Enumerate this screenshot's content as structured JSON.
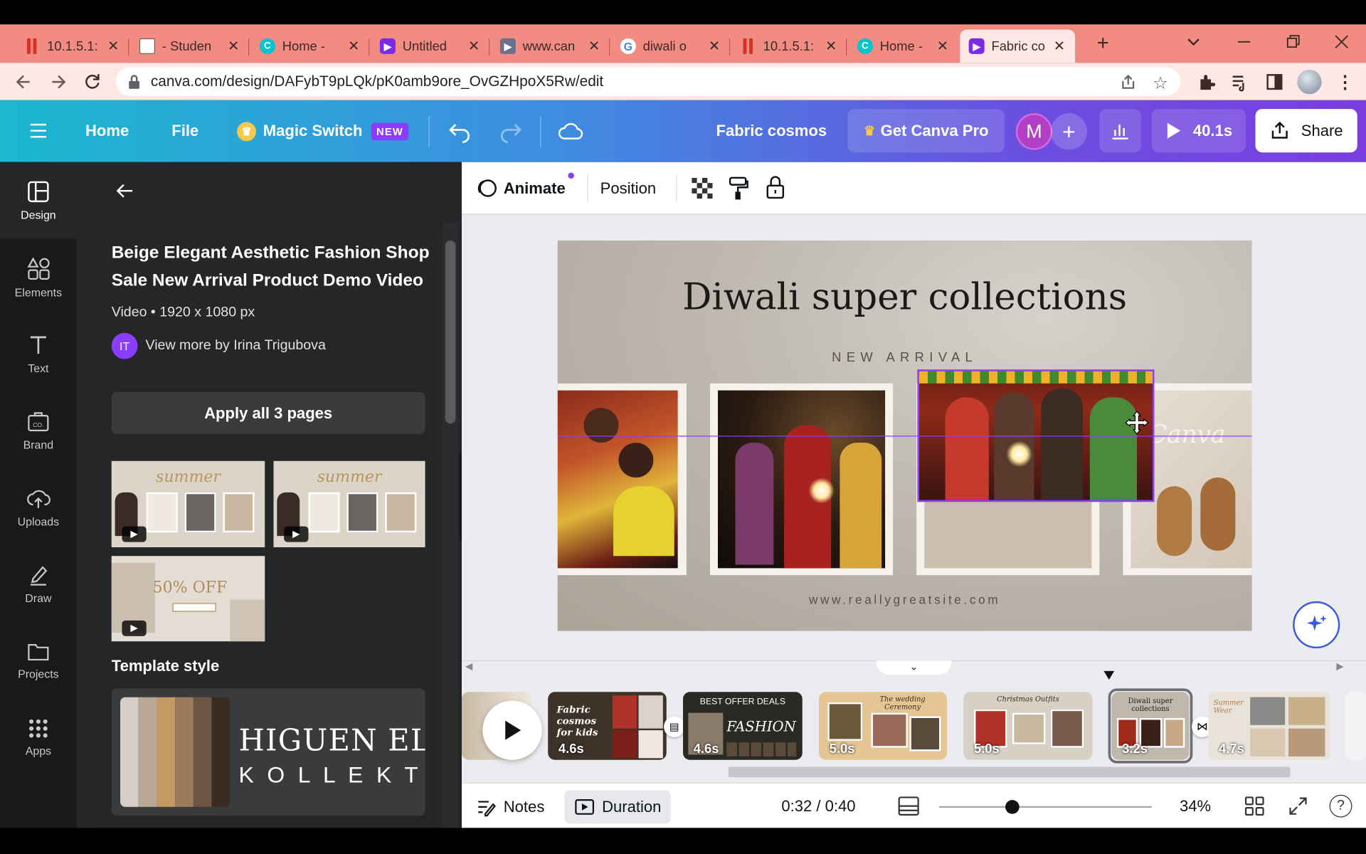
{
  "browser": {
    "tabs": [
      {
        "label": "10.1.5.1:",
        "favicon": "pause-bars"
      },
      {
        "label": "- Studen",
        "favicon": "student-portal"
      },
      {
        "label": "Home -",
        "favicon": "canva"
      },
      {
        "label": "Untitled",
        "favicon": "video"
      },
      {
        "label": "www.can",
        "favicon": "video-play"
      },
      {
        "label": "diwali o",
        "favicon": "google"
      },
      {
        "label": "10.1.5.1:",
        "favicon": "pause-bars"
      },
      {
        "label": "Home -",
        "favicon": "canva"
      },
      {
        "label": "Fabric co",
        "favicon": "video",
        "active": true
      }
    ],
    "url": "canva.com/design/DAFybT9pLQk/pK0amb9ore_OvGZHpoX5Rw/edit"
  },
  "header": {
    "home": "Home",
    "file": "File",
    "magic_switch": "Magic Switch",
    "new_badge": "NEW",
    "title": "Fabric cosmos",
    "get_pro": "Get Canva Pro",
    "avatar_letter": "M",
    "play_time": "40.1s",
    "share": "Share"
  },
  "rail": {
    "items": [
      {
        "label": "Design",
        "icon": "design-icon"
      },
      {
        "label": "Elements",
        "icon": "elements-icon"
      },
      {
        "label": "Text",
        "icon": "text-icon"
      },
      {
        "label": "Brand",
        "icon": "brand-icon"
      },
      {
        "label": "Uploads",
        "icon": "uploads-icon"
      },
      {
        "label": "Draw",
        "icon": "draw-icon"
      },
      {
        "label": "Projects",
        "icon": "projects-icon"
      },
      {
        "label": "Apps",
        "icon": "apps-icon"
      }
    ]
  },
  "panel": {
    "template_title": "Beige Elegant Aesthetic Fashion Shop Sale New Arrival Product Demo Video",
    "meta": "Video • 1920 x 1080 px",
    "author_initials": "IT",
    "author_link": "View more by Irina Trigubova",
    "apply_button": "Apply all 3 pages",
    "thumb_texts": [
      "summer",
      "summer",
      "50% OFF"
    ],
    "template_style_heading": "Template style",
    "style_text_1": "HIGUEN ELE",
    "style_text_2": "K O L L E K T I",
    "style_colors": [
      "#d6cfc7",
      "#b9a895",
      "#c49a62",
      "#9c7a5c",
      "#6e5443",
      "#3a2b22"
    ]
  },
  "toolbar": {
    "animate": "Animate",
    "position": "Position"
  },
  "canvas": {
    "headline": "Diwali super collections",
    "subheading": "NEW ARRIVAL",
    "website": "www.reallygreatsite.com",
    "watermark": "Canva"
  },
  "timeline": {
    "pages": [
      {
        "duration": "",
        "caption": ""
      },
      {
        "duration": "4.6s",
        "caption": "Fabric cosmos for kids"
      },
      {
        "duration": "4.6s",
        "caption": "BEST OFFER DEALS"
      },
      {
        "duration": "5.0s",
        "caption": "The wedding Ceremony"
      },
      {
        "duration": "5.0s",
        "caption": "Christmas Outfits"
      },
      {
        "duration": "3.2s",
        "caption": "Diwali super collections"
      },
      {
        "duration": "4.7s",
        "caption": "Summer Wear"
      }
    ],
    "fashion_word": "FASHION"
  },
  "bottom": {
    "notes": "Notes",
    "duration": "Duration",
    "time": "0:32 / 0:40",
    "zoom": "34%",
    "zoom_fraction": 0.34
  },
  "colors": {
    "canva_purple": "#8b3dff",
    "selection": "#8b3dff",
    "tabstrip": "#f28b82"
  }
}
